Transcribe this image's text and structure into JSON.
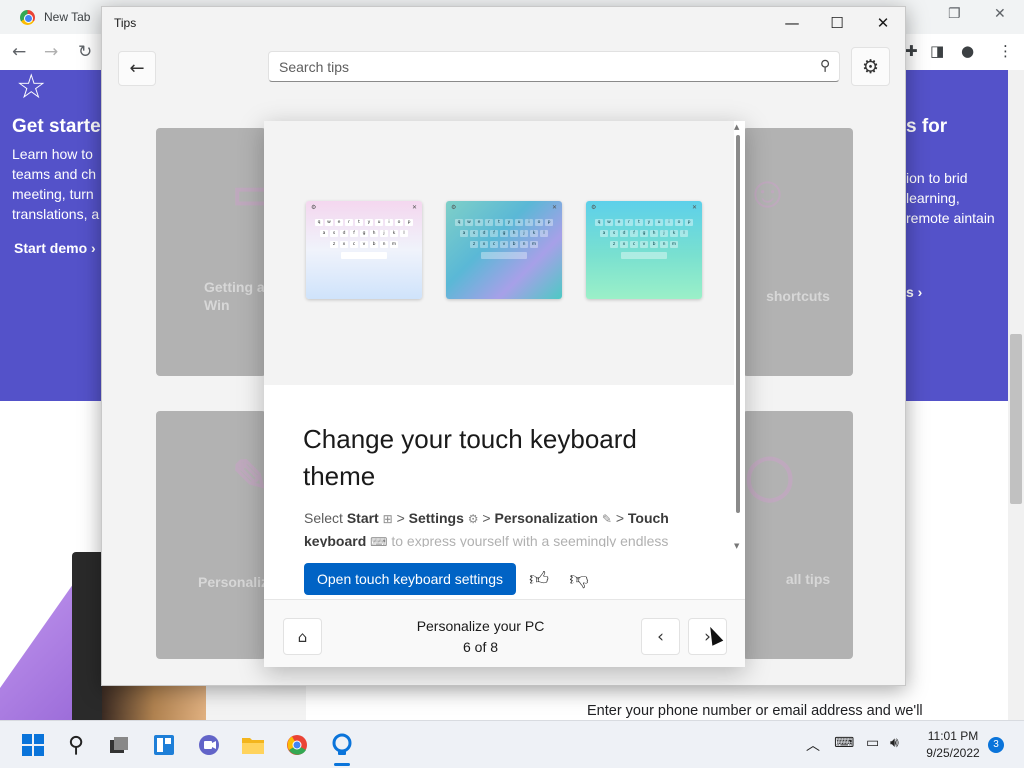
{
  "browser": {
    "tab_title": "New Tab",
    "hero_left": {
      "title": "Get starte",
      "text": "Learn how to teams and ch meeting, turn translations, a",
      "link": "Start demo"
    },
    "hero_right": {
      "title": "s for",
      "text": "ion to brid learning, remote aintain",
      "link": "s"
    },
    "bottom_text": "Enter your phone number or email address and we'll"
  },
  "tips_window": {
    "title": "Tips",
    "search": {
      "placeholder": "Search tips"
    },
    "cards": {
      "top_left": "Getting a Win",
      "top_right": "shortcuts",
      "bottom_left": "Personaliz",
      "bottom_right": "all tips"
    }
  },
  "tip": {
    "heading": "Change your touch keyboard theme",
    "body": {
      "select": "Select",
      "start": "Start",
      "settings": "Settings",
      "personalization": "Personalization",
      "touch_keyboard": "Touch keyboard",
      "rest": "to express yourself with a seemingly endless",
      "separator": ">"
    },
    "primary_button": "Open touch keyboard settings",
    "keyboard_rows": [
      [
        "q",
        "w",
        "e",
        "r",
        "t",
        "y",
        "u",
        "i",
        "o",
        "p"
      ],
      [
        "a",
        "s",
        "d",
        "f",
        "g",
        "h",
        "j",
        "k",
        "l"
      ],
      [
        "z",
        "x",
        "c",
        "v",
        "b",
        "n",
        "m"
      ]
    ],
    "footer": {
      "title": "Personalize your PC",
      "count": "6 of 8"
    }
  },
  "taskbar": {
    "time": "11:01 PM",
    "date": "9/25/2022",
    "notifications": "3"
  },
  "colors": {
    "hero": "#5452c9",
    "primary_button": "#0063c5",
    "accent": "#0a74da"
  }
}
